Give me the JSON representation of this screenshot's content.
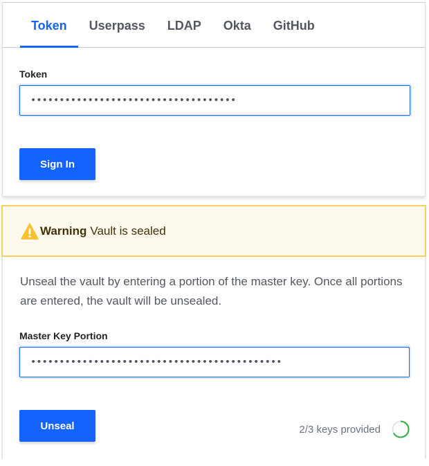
{
  "auth": {
    "tabs": [
      {
        "label": "Token",
        "active": true
      },
      {
        "label": "Userpass",
        "active": false
      },
      {
        "label": "LDAP",
        "active": false
      },
      {
        "label": "Okta",
        "active": false
      },
      {
        "label": "GitHub",
        "active": false
      }
    ],
    "token_label": "Token",
    "token_value": "••••••••••••••••••••••••••••••••••••",
    "sign_in_label": "Sign In"
  },
  "warning": {
    "icon": "warning-triangle-icon",
    "title": "Warning",
    "message": "Vault is sealed",
    "color": "#fbd05f"
  },
  "unseal": {
    "description": "Unseal the vault by entering a portion of the master key. Once all portions are entered, the vault will be unsealed.",
    "key_label": "Master Key Portion",
    "key_value": "••••••••••••••••••••••••••••••••••••••••••••",
    "unseal_label": "Unseal",
    "progress_text": "2/3 keys provided",
    "progress_provided": 2,
    "progress_required": 3,
    "progress_color": "#2eb039"
  },
  "colors": {
    "accent": "#1563ff"
  }
}
